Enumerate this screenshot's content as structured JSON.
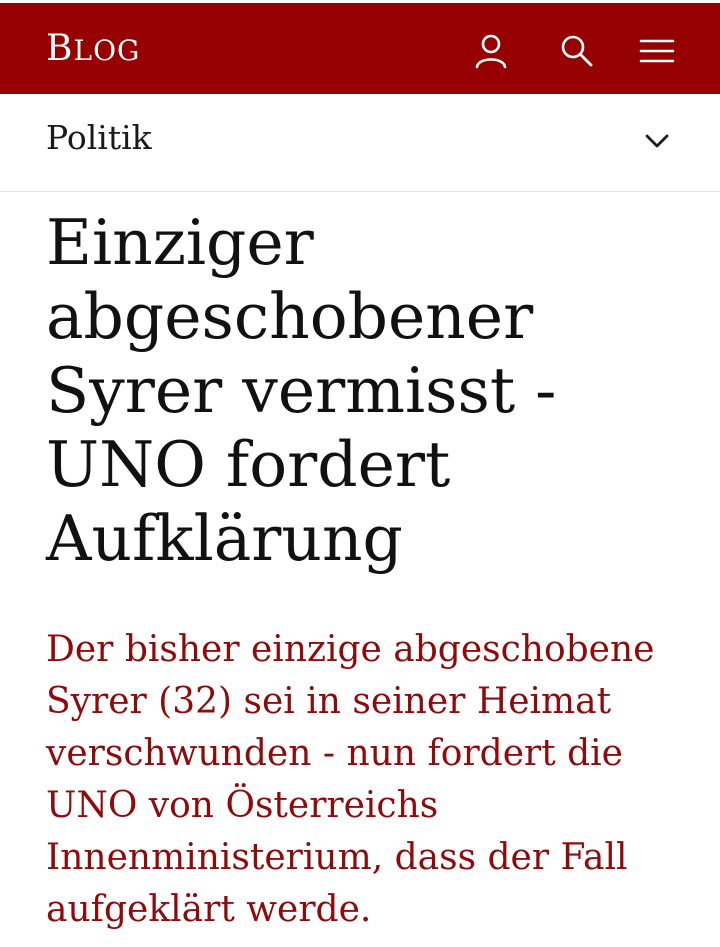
{
  "header": {
    "logo_first": "B",
    "logo_rest": "LOG",
    "icons": [
      "user-icon",
      "search-icon",
      "menu-icon"
    ]
  },
  "section": {
    "label": "Politik"
  },
  "article": {
    "headline": "Einziger abgeschobener Syrer vermisst - UNO fordert Aufklärung",
    "lead": "Der bisher einzige abgeschobene Syrer (32) sei in seiner Heimat verschwunden - nun fordert die UNO von Österreichs Innenministerium, dass der Fall aufgeklärt werde."
  },
  "colors": {
    "brand": "#970000",
    "lead_text": "#8f0b0b",
    "headline_text": "#111111"
  }
}
